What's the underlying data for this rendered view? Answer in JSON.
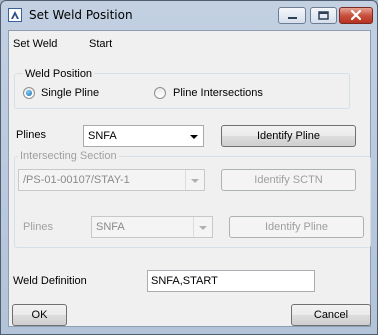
{
  "window": {
    "title": "Set Weld Position"
  },
  "set_weld": {
    "label": "Set Weld",
    "value": "Start"
  },
  "weld_position": {
    "group_label": "Weld Position",
    "options": [
      "Single Pline",
      "Pline Intersections"
    ],
    "selected": "Single Pline"
  },
  "plines": {
    "label": "Plines",
    "value": "SNFA",
    "button_label": "Identify Pline"
  },
  "intersecting_section": {
    "group_label": "Intersecting Section",
    "section_value": "/PS-01-00107/STAY-1",
    "section_button_label": "Identify SCTN",
    "plines_label": "Plines",
    "plines_value": "SNFA",
    "plines_button_label": "Identify Pline"
  },
  "weld_definition": {
    "label": "Weld Definition",
    "value": "SNFA,START"
  },
  "footer": {
    "ok_label": "OK",
    "cancel_label": "Cancel"
  },
  "icons": [
    "app-icon",
    "minimize-icon",
    "maximize-icon",
    "close-icon",
    "dropdown-arrow-icon"
  ]
}
